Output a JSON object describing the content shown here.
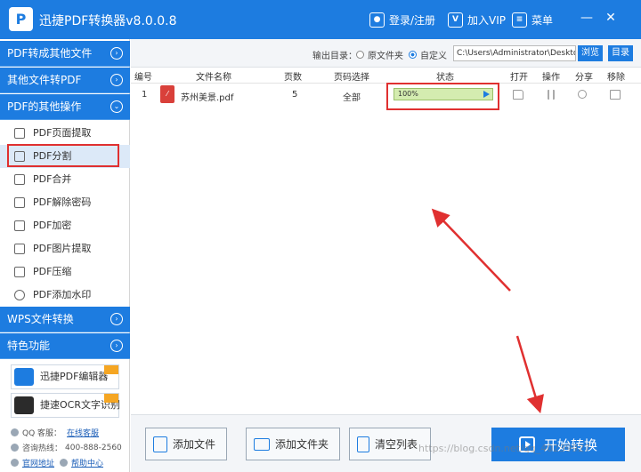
{
  "app": {
    "title": "迅捷PDF转换器v8.0.0.8",
    "logo": "P"
  },
  "titlebar": {
    "login": "登录/注册",
    "vip": "加入VIP",
    "menu": "菜单",
    "minimize": "—",
    "close": "✕"
  },
  "sidebar": {
    "categories": [
      {
        "label": "PDF转成其他文件"
      },
      {
        "label": "其他文件转PDF"
      },
      {
        "label": "PDF的其他操作"
      },
      {
        "label": "WPS文件转换"
      },
      {
        "label": "特色功能"
      }
    ],
    "items": [
      {
        "label": "PDF页面提取",
        "icon": "page-extract-icon"
      },
      {
        "label": "PDF分割",
        "icon": "split-icon"
      },
      {
        "label": "PDF合并",
        "icon": "merge-icon"
      },
      {
        "label": "PDF解除密码",
        "icon": "unlock-icon"
      },
      {
        "label": "PDF加密",
        "icon": "lock-icon"
      },
      {
        "label": "PDF图片提取",
        "icon": "image-extract-icon"
      },
      {
        "label": "PDF压缩",
        "icon": "compress-icon"
      },
      {
        "label": "PDF添加水印",
        "icon": "watermark-icon"
      }
    ],
    "promos": [
      {
        "label": "迅捷PDF编辑器",
        "logo": "PDF"
      },
      {
        "label": "捷速OCR文字识别",
        "logo": "OCR"
      }
    ],
    "contact": {
      "qq_label": "QQ 客服：",
      "qq_link": "在线客服",
      "phone_label": "咨询热线：",
      "phone": "400-888-2560",
      "site_link": "官网地址",
      "help_link": "帮助中心"
    }
  },
  "output": {
    "label": "输出目录：",
    "option_source": "原文件夹",
    "option_custom": "自定义",
    "path": "C:\\Users\\Administrator\\Deskto",
    "browse": "浏览",
    "open_dir": "目录"
  },
  "table": {
    "headers": [
      "编号",
      "文件名称",
      "页数",
      "页码选择",
      "状态",
      "打开",
      "操作",
      "分享",
      "移除"
    ],
    "rows": [
      {
        "index": "1",
        "name": "苏州美景.pdf",
        "pages": "5",
        "range": "全部",
        "status": "100%",
        "progress": 1.0
      }
    ]
  },
  "bottom": {
    "add_file": "添加文件",
    "add_folder": "添加文件夹",
    "clear_list": "清空列表",
    "start": "开始转换"
  },
  "watermark": "https://blog.csdn.net/qq_40239927",
  "colors": {
    "accent": "#1d7ce0",
    "highlight": "#e03030",
    "progress": "#d4ecb0"
  }
}
